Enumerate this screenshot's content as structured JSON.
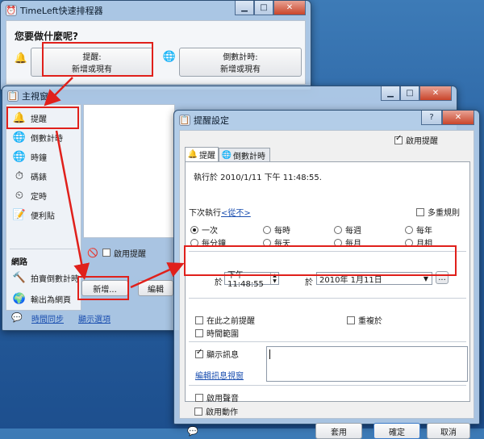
{
  "colors": {
    "annotation": "#e0201b",
    "link": "#1b4fb0"
  },
  "win1": {
    "title": "TimeLeft快速排程器",
    "heading": "您要做什麼呢?",
    "choice_reminder": {
      "line1": "提醒:",
      "line2": "新增或現有"
    },
    "choice_countdown": {
      "line1": "倒數計時:",
      "line2": "新增或現有"
    }
  },
  "win2": {
    "title": "主視窗",
    "sidebar": [
      {
        "label": "提醒",
        "icon": "bell-icon"
      },
      {
        "label": "倒數計時",
        "icon": "globe-icon"
      },
      {
        "label": "時鐘",
        "icon": "globe-icon"
      },
      {
        "label": "碼錶",
        "icon": "stopwatch-icon"
      },
      {
        "label": "定時",
        "icon": "clock-icon"
      },
      {
        "label": "便利貼",
        "icon": "sticky-note-icon"
      }
    ],
    "network_header": "網路",
    "network_items": [
      {
        "label": "拍賣倒數計時",
        "icon": "hammer-icon"
      },
      {
        "label": "輸出為網頁",
        "icon": "web-icon"
      }
    ],
    "enable_reminder": "啟用提醒",
    "new_button": "新增...",
    "edit_button": "編輯",
    "footer_links": [
      "時間同步",
      "顯示選項"
    ]
  },
  "dialog": {
    "title": "提醒設定",
    "enable_reminder": "啟用提醒",
    "tabs": [
      "提醒",
      "倒數計時"
    ],
    "exec_at": "執行於 2010/1/11  下午 11:48:55.",
    "next_exec_label": "下次執行",
    "next_exec_link": "<從不>",
    "multi_rule": "多重規則",
    "frequencies": [
      "一次",
      "每時",
      "每週",
      "每年",
      "每分鐘",
      "每天",
      "每月",
      "月相"
    ],
    "selected_frequency": "一次",
    "at_label": "於",
    "time_value": "下午 11:48:55",
    "on_label": "於",
    "date_value": "2010年  1月11日",
    "ellipsis_button": "...",
    "remind_before": "在此之前提醒",
    "repeat_on": "重複於",
    "time_range": "時間範圍",
    "show_message": "顯示訊息",
    "edit_message_link": "編輯訊息視窗",
    "enable_sound": "啟用聲音",
    "enable_action": "啟用動作",
    "buttons": {
      "apply": "套用",
      "ok": "確定",
      "cancel": "取消"
    }
  }
}
